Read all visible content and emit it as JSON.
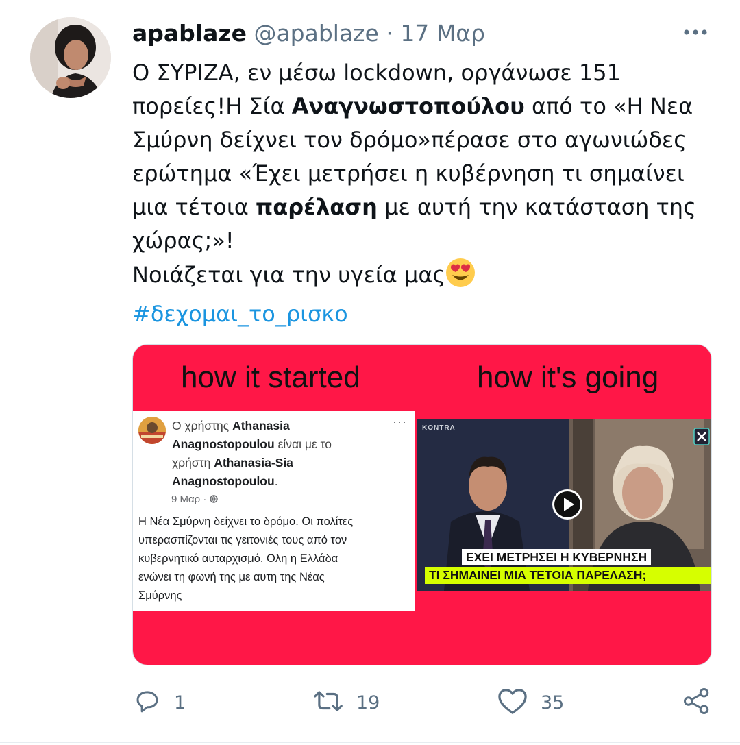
{
  "tweet": {
    "display_name": "apablaze",
    "handle": "@apablaze",
    "separator": "·",
    "date": "17 Μαρ",
    "text_lines": [
      [
        "Ο ΣΥΡΙΖΑ, εν μέσω lockdown, οργάνωσε 151"
      ],
      [
        "πορείες!Η Σία ",
        "Αναγνωστοπούλου",
        " από το «Η Νεα"
      ],
      [
        "Σμύρνη δείχνει τον δρόμο»πέρασε στο αγωνιώδες"
      ],
      [
        "ερώτημα «Έχει μετρήσει η κυβέρνηση τι σημαίνει"
      ],
      [
        "μια τέτοια ",
        "παρέλαση",
        " με αυτή την κατάσταση της"
      ],
      [
        "χώρας;»!"
      ],
      [
        "Νοιάζεται για την υγεία μας"
      ]
    ],
    "emoji": "heart-eyes-emoji",
    "hashtag": "#δεχομαι_το_ρισκο",
    "more_icon": "more-icon"
  },
  "media": {
    "bg_color": "#ff1747",
    "caption_left": "how it started",
    "caption_right": "how it's going",
    "fb_post": {
      "line1_prefix": "Ο χρήστης ",
      "line1_name": "Athanasia",
      "line2_name": "Anagnostopoulou",
      "line2_suffix": " είναι με το",
      "line3_prefix": "χρήστη ",
      "line3_name": "Athanasia-Sia",
      "line4_name": "Anagnostopoulou",
      "line4_suffix": ".",
      "date": "9 Μαρ · ",
      "more": "···",
      "text_lines": [
        "Η Νέα Σμύρνη δείχνει το δρόμο.  Οι πολίτες",
        "υπερασπίζονται τις γειτονιές τους από τον",
        "κυβερνητικό αυταρχισμό.  Ολη η Ελλάδα",
        "ενώνει τη φωνή της με αυτη της Νέας",
        "Σμύρνης"
      ]
    },
    "video": {
      "channel_logo": "KONTRA",
      "chyron_line1": "ΕΧΕΙ ΜΕΤΡΗΣΕΙ Η ΚΥΒΕΡΝΗΣΗ",
      "chyron_line2": "ΤΙ ΣΗΜΑΙΝΕΙ ΜΙΑ ΤΕΤΟΙΑ ΠΑΡΕΛΑΣΗ;",
      "chyron_colors": [
        "#ffffff",
        "#d6ff00"
      ]
    }
  },
  "actions": {
    "reply_count": "1",
    "retweet_count": "19",
    "like_count": "35"
  },
  "colors": {
    "text": "#0f1419",
    "muted": "#5b7083",
    "link": "#1b95e0"
  }
}
